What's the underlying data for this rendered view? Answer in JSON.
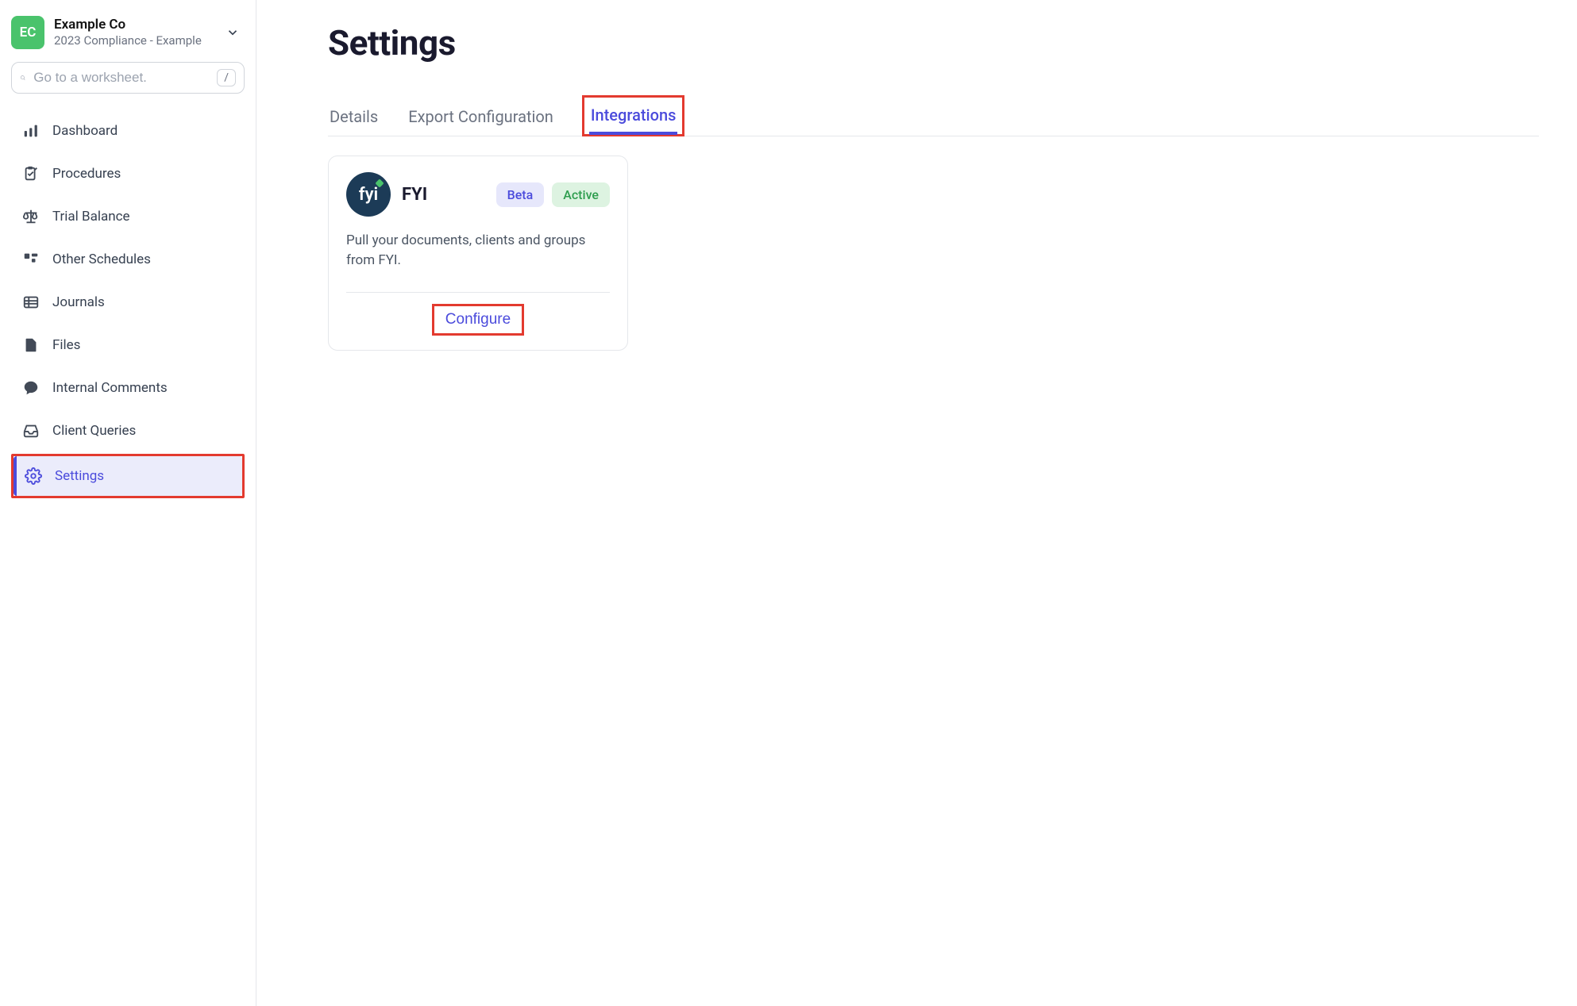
{
  "workspace": {
    "initials": "EC",
    "name": "Example Co",
    "subtitle": "2023 Compliance - Example"
  },
  "search": {
    "placeholder": "Go to a worksheet.",
    "shortcut": "/"
  },
  "sidebar": {
    "items": [
      {
        "label": "Dashboard"
      },
      {
        "label": "Procedures"
      },
      {
        "label": "Trial Balance"
      },
      {
        "label": "Other Schedules"
      },
      {
        "label": "Journals"
      },
      {
        "label": "Files"
      },
      {
        "label": "Internal Comments"
      },
      {
        "label": "Client Queries"
      },
      {
        "label": "Settings"
      }
    ]
  },
  "page": {
    "title": "Settings",
    "tabs": [
      {
        "label": "Details"
      },
      {
        "label": "Export Configuration"
      },
      {
        "label": "Integrations"
      }
    ]
  },
  "integration_card": {
    "logo_text": "fyi",
    "title": "FYI",
    "badges": {
      "beta": "Beta",
      "active": "Active"
    },
    "description": "Pull your documents, clients and groups from FYI.",
    "configure_label": "Configure"
  }
}
